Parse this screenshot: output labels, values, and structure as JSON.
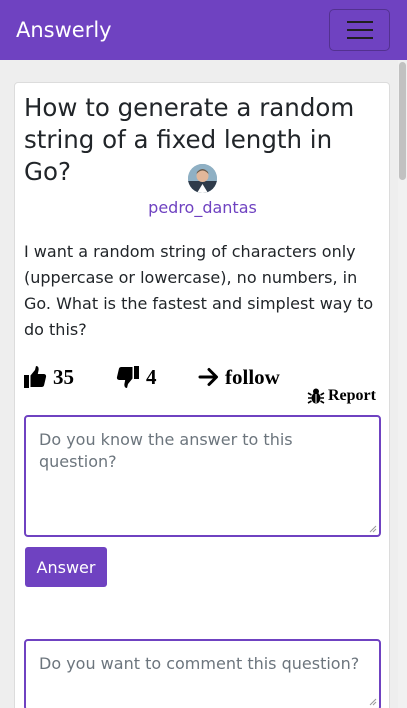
{
  "navbar": {
    "brand": "Answerly",
    "menu_icon": "hamburger-icon",
    "color": "#6f42c1"
  },
  "question": {
    "title": "How to generate a random string of a fixed length in Go?",
    "author": "pedro_dantas",
    "body": "I want a random string of characters only (uppercase or lowercase), no numbers, in Go. What is the fastest and simplest way to do this?",
    "upvotes": "35",
    "downvotes": "4",
    "follow_label": "follow",
    "report_label": "Report"
  },
  "answer_form": {
    "placeholder": "Do you know the answer to this question?",
    "button_label": "Answer"
  },
  "comment_form": {
    "placeholder": "Do you want to comment this question?"
  },
  "colors": {
    "accent": "#6f42c1",
    "background": "#eeeeee"
  }
}
